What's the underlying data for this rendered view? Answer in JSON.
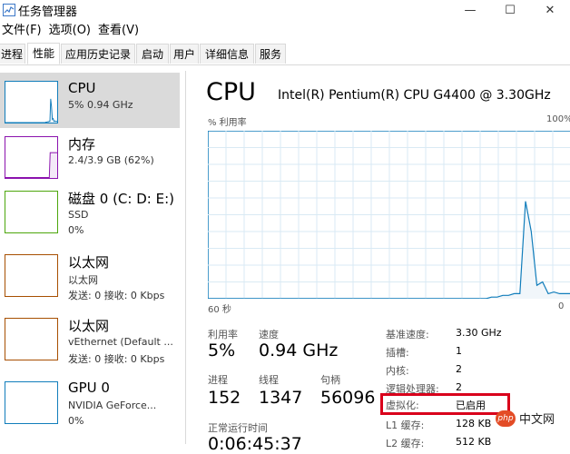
{
  "window": {
    "title": "任务管理器",
    "minimize": "—",
    "maximize": "☐",
    "close": "✕"
  },
  "menu": [
    "文件(F)",
    "选项(O)",
    "查看(V)"
  ],
  "tabs": [
    "进程",
    "性能",
    "应用历史记录",
    "启动",
    "用户",
    "详细信息",
    "服务"
  ],
  "active_tab": "性能",
  "sidebar": {
    "items": [
      {
        "title": "CPU",
        "lines": [
          "5% 0.94 GHz"
        ],
        "color": "#117dbb",
        "selected": true
      },
      {
        "title": "内存",
        "lines": [
          "2.4/3.9 GB (62%)"
        ],
        "color": "#8b12ae",
        "usage": 0.62
      },
      {
        "title": "磁盘 0 (C: D: E:)",
        "lines": [
          "SSD",
          "0%"
        ],
        "color": "#4da60c"
      },
      {
        "title": "以太网",
        "lines": [
          "以太网",
          "发送: 0 接收: 0 Kbps"
        ],
        "color": "#a74f01"
      },
      {
        "title": "以太网",
        "lines": [
          "vEthernet (Default ...",
          "发送: 0 接收: 0 Kbps"
        ],
        "color": "#a74f01"
      },
      {
        "title": "GPU 0",
        "lines": [
          "NVIDIA GeForce...",
          "0%"
        ],
        "color": "#117dbb"
      }
    ]
  },
  "cpu": {
    "title": "CPU",
    "model": "Intel(R) Pentium(R) CPU G4400 @ 3.30GHz",
    "graph_ylabel": "% 利用率",
    "graph_ymax": "100%",
    "graph_time": "60 秒",
    "graph_ymin": "0",
    "history": [
      0,
      0,
      0,
      0,
      0,
      0,
      0,
      0,
      0,
      0,
      0,
      0,
      0,
      0,
      0,
      0,
      0,
      0,
      0,
      0,
      0,
      0,
      0,
      0,
      0,
      0,
      0,
      0,
      0,
      0,
      0,
      0,
      0,
      0,
      0,
      0,
      0,
      0,
      0,
      0,
      0,
      0,
      0,
      0,
      0,
      0,
      0,
      0,
      0,
      0,
      1,
      1,
      2,
      2,
      3,
      3,
      58,
      40,
      8,
      10,
      3,
      4,
      3,
      3,
      3
    ],
    "stats": {
      "util_label": "利用率",
      "util_value": "5%",
      "speed_label": "速度",
      "speed_value": "0.94 GHz",
      "proc_label": "进程",
      "proc_value": "152",
      "thread_label": "线程",
      "thread_value": "1347",
      "handle_label": "句柄",
      "handle_value": "56096",
      "uptime_label": "正常运行时间",
      "uptime_value": "0:06:45:37"
    },
    "specs": [
      {
        "label": "基准速度:",
        "value": "3.30 GHz"
      },
      {
        "label": "插槽:",
        "value": "1"
      },
      {
        "label": "内核:",
        "value": "2"
      },
      {
        "label": "逻辑处理器:",
        "value": "2"
      },
      {
        "label": "虚拟化:",
        "value": "已启用"
      },
      {
        "label": "L1 缓存:",
        "value": "128 KB"
      },
      {
        "label": "L2 缓存:",
        "value": "512 KB"
      }
    ]
  },
  "watermark": {
    "icon": "php",
    "text": "中文网"
  }
}
